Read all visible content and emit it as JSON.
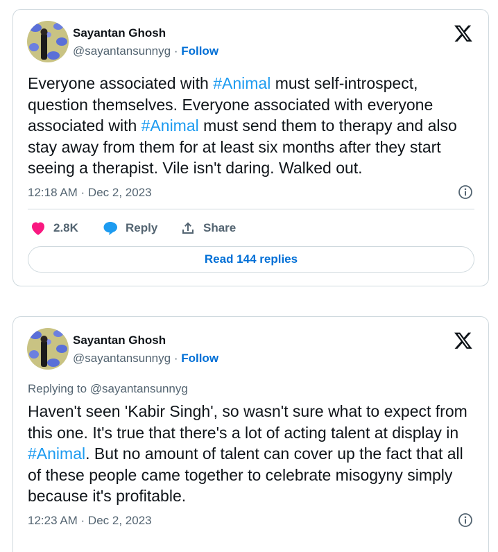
{
  "tweets": [
    {
      "author_name": "Sayantan Ghosh",
      "handle": "@sayantansunnyg",
      "separator": "·",
      "follow_label": "Follow",
      "body_parts": {
        "p1": "Everyone associated with ",
        "tag1": "#Animal",
        "p2": " must self-introspect, question themselves. Everyone associated with everyone associated with ",
        "tag2": "#Animal",
        "p3": " must send them to therapy and also stay away from them for at least six months after they start seeing a therapist. Vile isn't daring. Walked out."
      },
      "timestamp": "12:18 AM · Dec 2, 2023",
      "likes": "2.8K",
      "reply_label": "Reply",
      "share_label": "Share",
      "read_replies_label": "Read 144 replies"
    },
    {
      "author_name": "Sayantan Ghosh",
      "handle": "@sayantansunnyg",
      "separator": "·",
      "follow_label": "Follow",
      "replying_to": "Replying to @sayantansunnyg",
      "body_parts": {
        "p1": "Haven't seen 'Kabir Singh', so wasn't sure what to expect from this one. It's true that there's a lot of acting talent at display in ",
        "tag1": "#Animal",
        "p2": ". But no amount of talent can cover up the fact that all of these people came together to celebrate misogyny simply because it's profitable."
      },
      "timestamp": "12:23 AM · Dec 2, 2023"
    }
  ],
  "icons": {
    "x_logo": "x-logo-icon",
    "info": "info-icon",
    "heart": "heart-icon",
    "reply": "reply-bubble-icon",
    "share": "share-upload-icon"
  },
  "colors": {
    "link_blue": "#006fd6",
    "hashtag_blue": "#1d9bf0",
    "heart_pink": "#f91880",
    "reply_blue": "#1d9bf0",
    "muted_gray": "#536471",
    "border": "#cfd9de"
  }
}
